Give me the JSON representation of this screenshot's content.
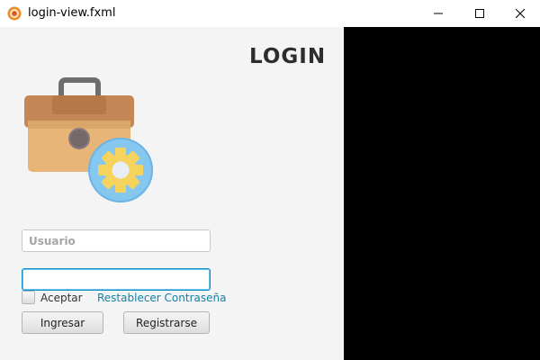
{
  "window": {
    "title": "login-view.fxml",
    "app_icon": "javafx-app-icon",
    "controls": [
      "minimize-icon",
      "maximize-icon",
      "close-icon"
    ]
  },
  "login": {
    "heading": "LOGIN",
    "illustration": "briefcase-gear-icon",
    "username": {
      "placeholder": "Usuario",
      "value": ""
    },
    "password": {
      "placeholder": "",
      "value": "",
      "focused": true
    },
    "accept_checkbox": {
      "label": "Aceptar",
      "checked": false
    },
    "reset_link": "Restablecer Contraseña",
    "login_button": "Ingresar",
    "register_button": "Registrarse"
  },
  "colors": {
    "panel_background": "#f4f4f4",
    "heading": "#2d2d2d",
    "link": "#1582a7",
    "focus_border": "#0f8fcc",
    "briefcase": "#e6b273",
    "gear_ring": "#7cc3ef",
    "gear": "#f5d25e"
  }
}
